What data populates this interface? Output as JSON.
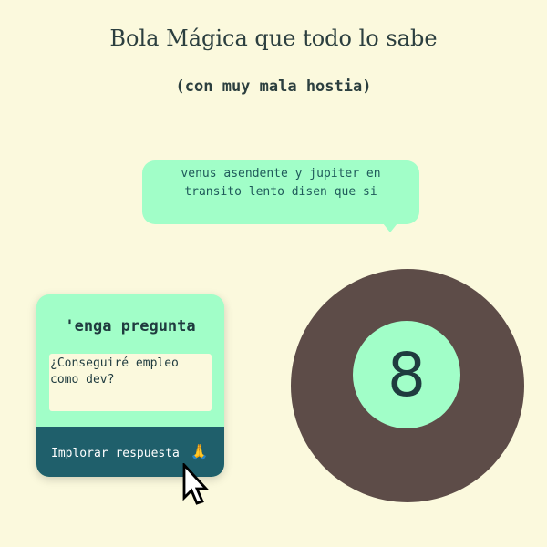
{
  "header": {
    "title": "Bola Mágica que todo lo sabe",
    "subtitle": "(con muy mala hostia)"
  },
  "answer_bubble": {
    "text": "venus asendente y jupiter en transito lento disen que si"
  },
  "question_card": {
    "title": "'enga pregunta",
    "question_value": "¿Conseguiré empleo como dev?",
    "submit_label": "Implorar respuesta",
    "submit_emoji": "🙏"
  },
  "magic_ball": {
    "number": "8"
  },
  "colors": {
    "background": "#fbf9dd",
    "mint": "#a1fec8",
    "ball": "#5d4c48",
    "button": "#1f5f6b",
    "text": "#1f3b3f"
  },
  "icons": {
    "cursor": "mouse-pointer-icon",
    "submit": "praying-hands-icon"
  }
}
